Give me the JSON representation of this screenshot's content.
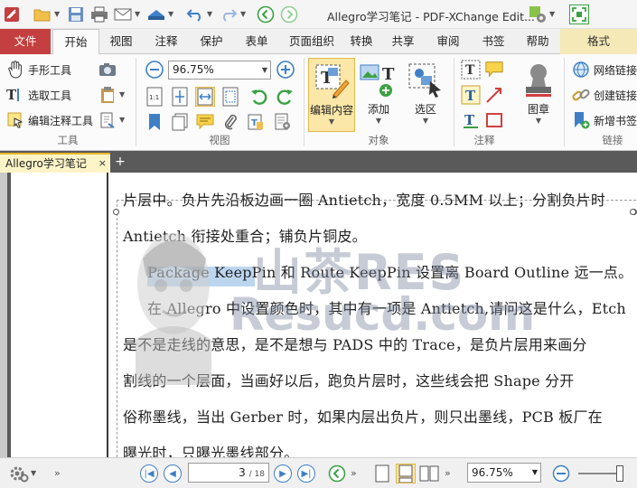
{
  "app": {
    "title": "Allegro学习笔记 - PDF-XChange Edit..."
  },
  "menu": {
    "tabs": [
      "文件",
      "开始",
      "视图",
      "注释",
      "保护",
      "表单",
      "页面组织",
      "转换",
      "共享",
      "审阅",
      "书签",
      "帮助",
      "格式"
    ],
    "active": "开始"
  },
  "ribbon": {
    "tools": {
      "hand": "手形工具",
      "select_text": "选取工具",
      "edit_annot": "编辑注释工具",
      "label": "工具"
    },
    "view": {
      "zoom": "96.75%",
      "label": "视图"
    },
    "objects": {
      "edit_content": "编辑内容",
      "add": "添加",
      "select_area": "选区",
      "label": "对象"
    },
    "annotations": {
      "label": "注释"
    },
    "stamp": {
      "label": "图章"
    },
    "links": {
      "web_link": "网络链接",
      "create_link": "创建链接",
      "add_bookmark": "新增书签",
      "label": "链接"
    }
  },
  "doc_tab": {
    "name": "Allegro学习笔记",
    "close": "×",
    "new": "+"
  },
  "page_text": {
    "lines": [
      "片层中。负片先沿板边画一圈 Antietch，宽度 0.5MM 以上；分割负片时",
      "Antietch 衔接处重合；铺负片铜皮。",
      "Package KeepPin 和 Route KeepPin 设置离 Board Outline 远一点。",
      "在 Allegro 中设置颜色时，其中有一项是 Antietch,请问这是什么，Etch",
      "是不是走线的意思，是不是想与 PADS 中的 Trace，是负片层用来画分",
      "割线的一个层面，当画好以后，跑负片层时，这些线会把 Shape 分开",
      "俗称墨线，当出 Gerber 时，如果内层出负片，则只出墨线，PCB 板厂在",
      "曝光时，只曝光墨线部分。"
    ]
  },
  "watermark": {
    "line1": "山茶RES",
    "line2": "Resucd.com"
  },
  "status": {
    "page_current": "3",
    "page_total": "/ 18",
    "zoom": "96.75%"
  }
}
